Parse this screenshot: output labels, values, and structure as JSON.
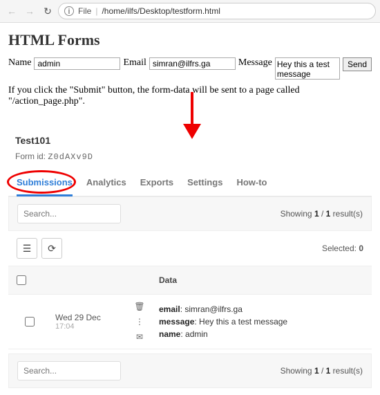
{
  "browser": {
    "file_label": "File",
    "path": "/home/ilfs/Desktop/testform.html"
  },
  "page_title": "HTML Forms",
  "form": {
    "name_label": "Name",
    "name_value": "admin",
    "email_label": "Email",
    "email_value": "simran@ilfrs.ga",
    "message_label": "Message",
    "message_value": "Hey this a test message",
    "send_label": "Send"
  },
  "hint_text": "If you click the \"Submit\" button, the form-data will be sent to a page called \"/action_page.php\".",
  "panel": {
    "form_name": "Test101",
    "form_id_label": "Form id:",
    "form_id_value": "Z0dAXv9D",
    "tabs": [
      "Submissions",
      "Analytics",
      "Exports",
      "Settings",
      "How-to"
    ],
    "active_tab": "Submissions",
    "search_placeholder": "Search...",
    "showing_prefix": "Showing ",
    "showing_count": "1",
    "showing_sep": " / ",
    "showing_total": "1",
    "showing_suffix": " result(s)",
    "selected_label": "Selected: ",
    "selected_count": "0",
    "data_header": "Data",
    "rows": [
      {
        "date": "Wed 29 Dec",
        "time": "17:04",
        "email_key": "email",
        "email_val": "simran@ilfrs.ga",
        "message_key": "message",
        "message_val": "Hey this a test message",
        "name_key": "name",
        "name_val": "admin"
      }
    ]
  }
}
